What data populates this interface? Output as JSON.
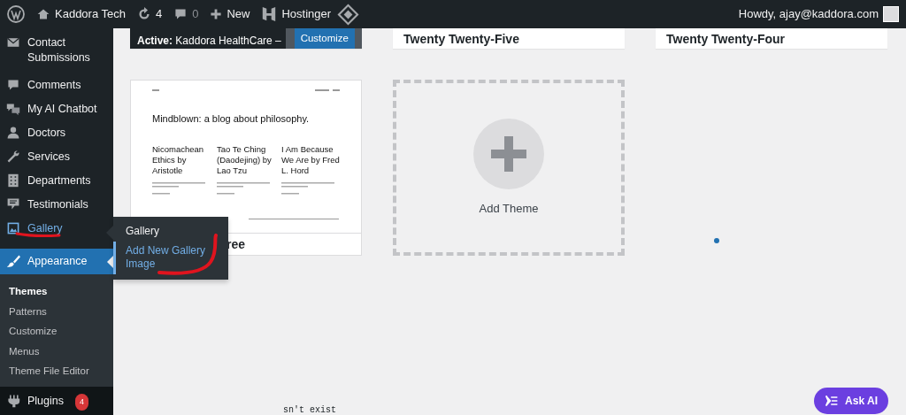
{
  "admin_bar": {
    "site_name": "Kaddora Tech",
    "updates": "4",
    "comments": "0",
    "new_label": "New",
    "hosting_label": "Hostinger",
    "greeting": "Howdy, ajay@kaddora.com"
  },
  "sidebar": {
    "items": [
      {
        "label": "Contact Submissions",
        "selected": false,
        "hovered": false
      },
      {
        "label": "Comments",
        "selected": false,
        "hovered": false
      },
      {
        "label": "My AI Chatbot",
        "selected": false,
        "hovered": false
      },
      {
        "label": "Doctors",
        "selected": false,
        "hovered": false
      },
      {
        "label": "Services",
        "selected": false,
        "hovered": false
      },
      {
        "label": "Departments",
        "selected": false,
        "hovered": false
      },
      {
        "label": "Testimonials",
        "selected": false,
        "hovered": false
      },
      {
        "label": "Gallery",
        "selected": false,
        "hovered": true
      },
      {
        "label": "Appearance",
        "selected": true,
        "hovered": false,
        "submenu": [
          {
            "label": "Themes",
            "selected": true
          },
          {
            "label": "Patterns",
            "selected": false
          },
          {
            "label": "Customize",
            "selected": false
          },
          {
            "label": "Menus",
            "selected": false
          },
          {
            "label": "Theme File Editor",
            "selected": false
          }
        ]
      },
      {
        "label": "Plugins",
        "selected": false,
        "hovered": false,
        "badge": "4"
      }
    ]
  },
  "flyout": {
    "items": [
      {
        "label": "Gallery",
        "selected": false
      },
      {
        "label": "Add New Gallery Image",
        "selected": true
      }
    ]
  },
  "themes": [
    {
      "kind": "active",
      "name": "**Active:** Kaddora HealthCare –",
      "button": "Customize"
    },
    {
      "kind": "theme",
      "name": "Twenty Twenty-Five"
    },
    {
      "kind": "theme",
      "name": "Twenty Twenty-Four"
    },
    {
      "kind": "preview",
      "name": "ree",
      "preview": {
        "heading": "Mindblown: a blog about philosophy.",
        "posts": [
          "Nicomachean Ethics by Aristotle",
          "Tao Te Ching (Daodejing) by Lao Tzu",
          "I Am Because We Are by Fred L. Hord"
        ]
      }
    },
    {
      "kind": "add",
      "label": "Add Theme"
    }
  ],
  "status_text": "sn't exist",
  "assistant_button": "Ask AI"
}
